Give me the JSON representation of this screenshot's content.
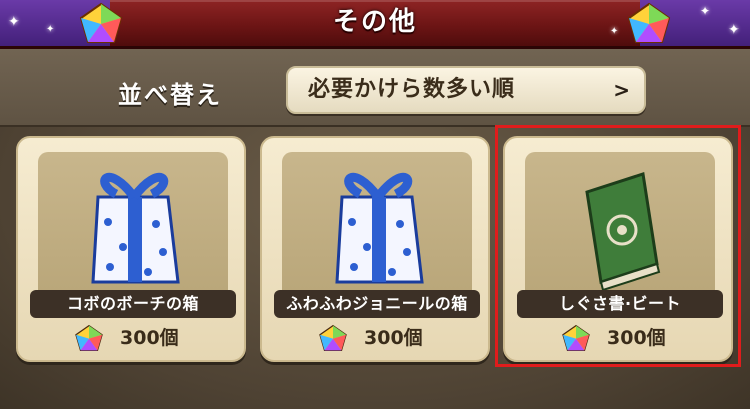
{
  "header": {
    "title": "その他",
    "icon": "rainbow-gem-icon"
  },
  "sort": {
    "label": "並べ替え",
    "selected": "必要かけら数多い順",
    "arrow": ">"
  },
  "items": [
    {
      "name": "コボのボーチの箱",
      "price": "300個",
      "image": "blue-gift-box-icon"
    },
    {
      "name": "ふわふわジョニールの箱",
      "price": "300個",
      "image": "blue-gift-box-icon"
    },
    {
      "name": "しぐさ書·ビート",
      "price": "300個",
      "image": "green-book-icon",
      "highlighted": true
    }
  ],
  "colors": {
    "header": "#7a1a1a",
    "highlight": "#e01c1c",
    "card": "#f2e6c8"
  }
}
